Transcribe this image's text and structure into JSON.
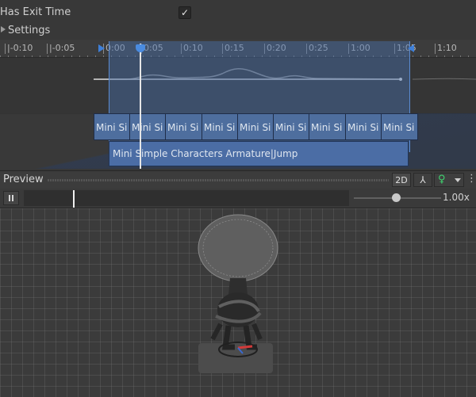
{
  "settings": {
    "has_exit_time_label": "Has Exit Time",
    "has_exit_time_checked": true,
    "check_mark": "✓",
    "settings_label": "Settings"
  },
  "timeline": {
    "ticks": [
      "|-0:10",
      "|-0:05",
      "0:00",
      "0:05",
      "0:10",
      "0:15",
      "0:20",
      "0:25",
      "1:00",
      "1:05",
      "1:10"
    ],
    "stripe_clip_label": "Mini Si",
    "clip_label": "Mini Simple Characters Armature|Jump"
  },
  "preview": {
    "title": "Preview",
    "btn_2d": "2D",
    "speed_label": "1.00x",
    "speed_value": 1.0
  },
  "colors": {
    "selection": "#466eaa",
    "playhead": "#e6e6e6",
    "avatar_icon": "#3fd36f"
  },
  "icons": {
    "pivot": "pivot-icon",
    "avatar": "avatar-icon",
    "more": "more-icon",
    "pause": "pause-icon"
  }
}
